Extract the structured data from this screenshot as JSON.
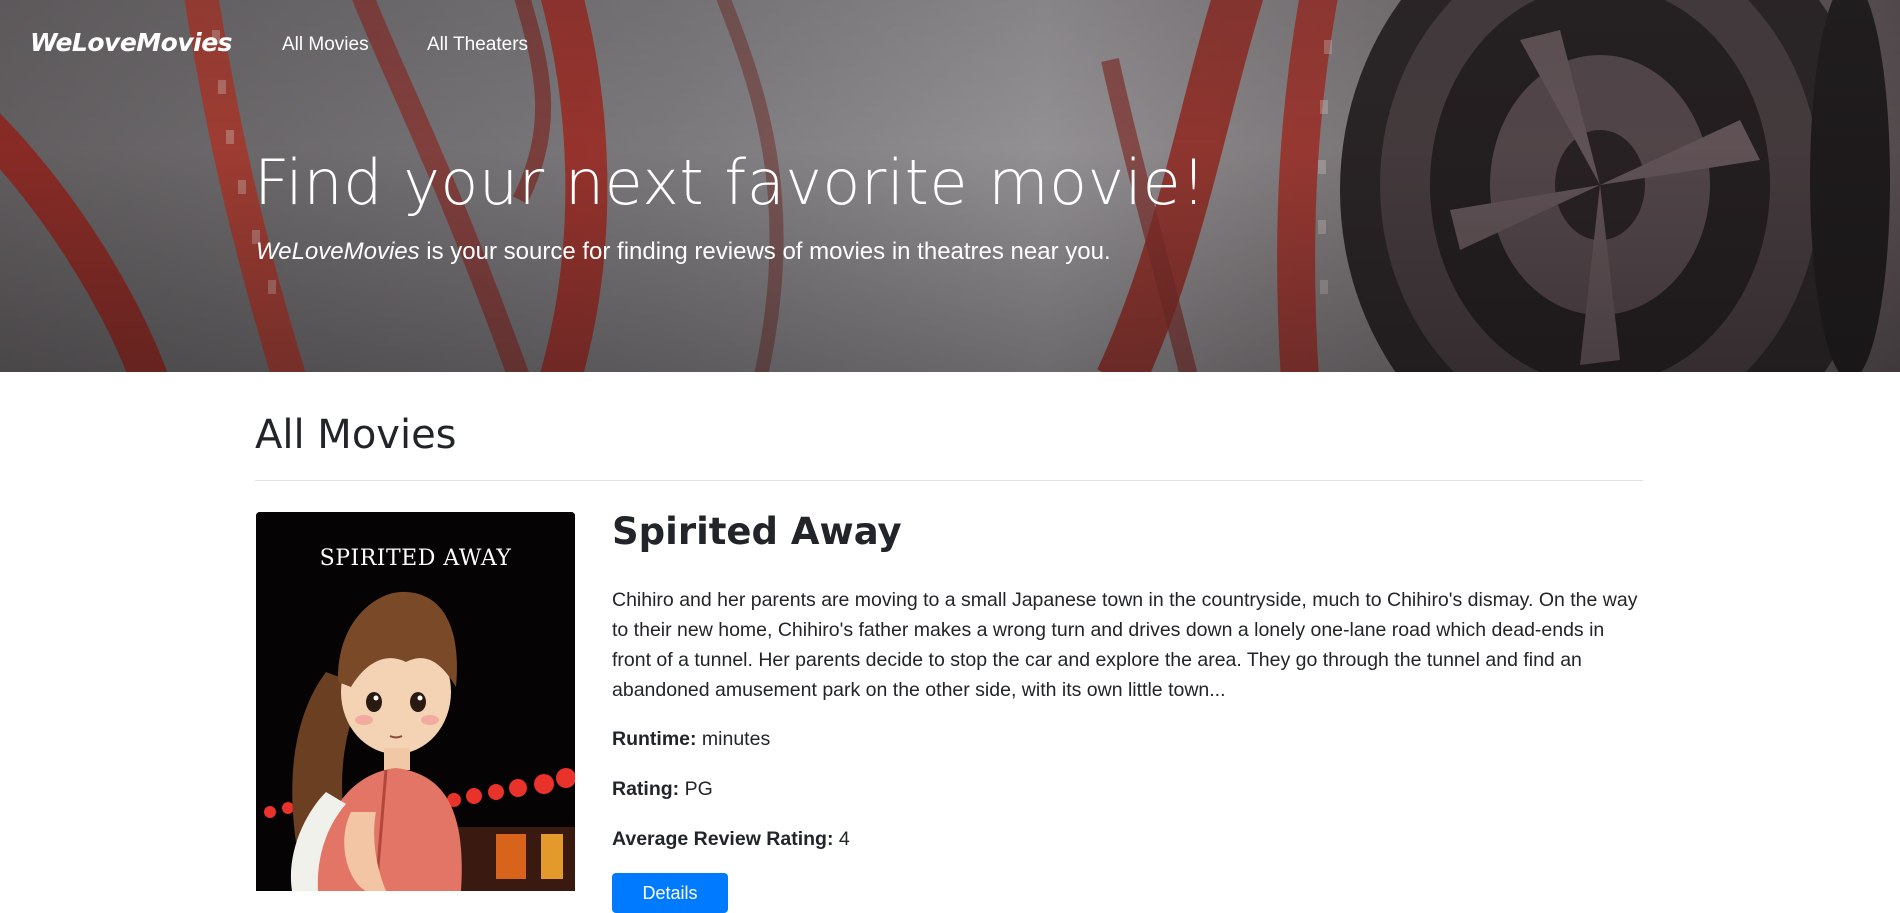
{
  "navbar": {
    "brand": "WeLoveMovies",
    "links": [
      {
        "label": "All Movies"
      },
      {
        "label": "All Theaters"
      }
    ]
  },
  "hero": {
    "title": "Find your next favorite movie!",
    "subtitle_brand": "WeLoveMovies",
    "subtitle_rest": " is your source for finding reviews of movies in theatres near you."
  },
  "main": {
    "heading": "All Movies",
    "movies": [
      {
        "title": "Spirited Away",
        "poster_caption": "SPIRITED AWAY",
        "description": "Chihiro and her parents are moving to a small Japanese town in the countryside, much to Chihiro's dismay. On the way to their new home, Chihiro's father makes a wrong turn and drives down a lonely one-lane road which dead-ends in front of a tunnel. Her parents decide to stop the car and explore the area. They go through the tunnel and find an abandoned amusement park on the other side, with its own little town...",
        "runtime_label": "Runtime:",
        "runtime_value": " minutes",
        "rating_label": "Rating:",
        "rating_value": " PG",
        "avg_label": "Average Review Rating:",
        "avg_value": " 4",
        "button_label": "Details"
      }
    ]
  },
  "colors": {
    "primary_button": "#007bff",
    "text": "#212529",
    "divider": "#dee2e6",
    "film_strip_red": "#b0261e"
  }
}
